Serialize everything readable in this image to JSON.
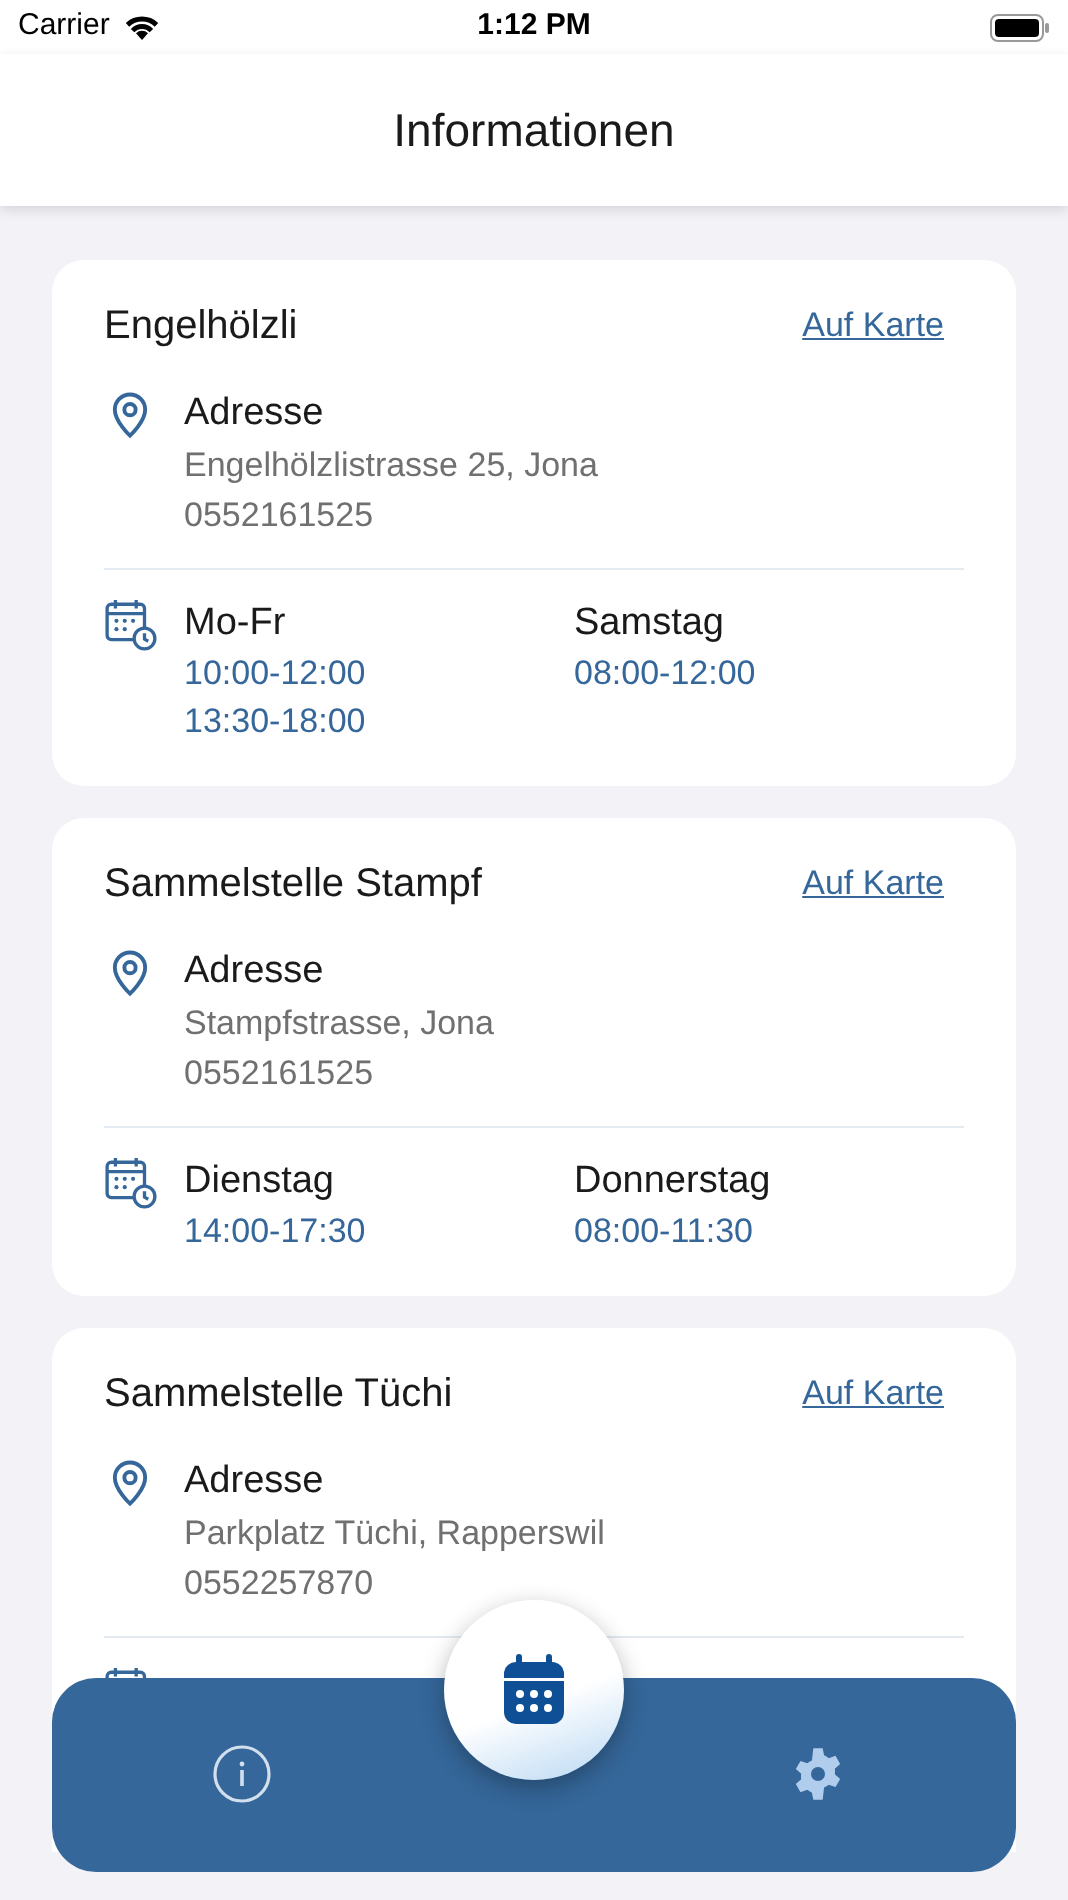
{
  "status_bar": {
    "carrier": "Carrier",
    "time": "1:12 PM"
  },
  "header": {
    "title": "Informationen"
  },
  "locations": [
    {
      "name": "Engelhölzli",
      "map_link": "Auf Karte",
      "address_label": "Adresse",
      "address": "Engelhölzlistrasse 25, Jona",
      "phone": "0552161525",
      "hours": [
        {
          "day": "Mo-Fr",
          "times": [
            "10:00-12:00",
            "13:30-18:00"
          ]
        },
        {
          "day": "Samstag",
          "times": [
            "08:00-12:00"
          ]
        }
      ]
    },
    {
      "name": "Sammelstelle Stampf",
      "map_link": "Auf Karte",
      "address_label": "Adresse",
      "address": "Stampfstrasse, Jona",
      "phone": "0552161525",
      "hours": [
        {
          "day": "Dienstag",
          "times": [
            "14:00-17:30"
          ]
        },
        {
          "day": "Donnerstag",
          "times": [
            "08:00-11:30"
          ]
        }
      ]
    },
    {
      "name": "Sammelstelle Tüchi",
      "map_link": "Auf Karte",
      "address_label": "Adresse",
      "address": "Parkplatz Tüchi, Rapperswil",
      "phone": "0552257870"
    }
  ],
  "tab_bar": {
    "items": [
      {
        "kind": "info",
        "selected": false
      },
      {
        "kind": "calendar",
        "selected": true
      },
      {
        "kind": "settings",
        "selected": false
      }
    ]
  }
}
